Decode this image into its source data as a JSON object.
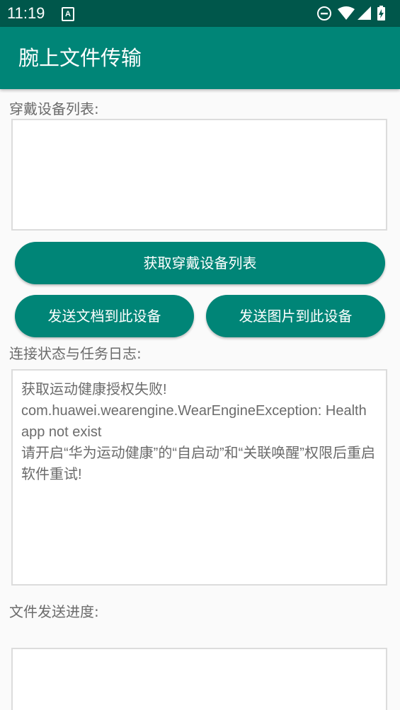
{
  "status_bar": {
    "time": "11:19",
    "notification_icon_letter": "A",
    "icons": [
      "dnd-icon",
      "wifi-icon",
      "signal-icon",
      "battery-icon"
    ]
  },
  "app_bar": {
    "title": "腕上文件传输"
  },
  "device_list": {
    "label": "穿戴设备列表:",
    "items": []
  },
  "buttons": {
    "get_devices": "获取穿戴设备列表",
    "send_document": "发送文档到此设备",
    "send_image": "发送图片到此设备"
  },
  "log": {
    "label": "连接状态与任务日志:",
    "text": "获取运动健康授权失败!\ncom.huawei.wearengine.WearEngineException: Health app not exist\n请开启“华为运动健康”的“自启动”和“关联唤醒”权限后重启软件重试!"
  },
  "progress": {
    "label": "文件发送进度:"
  },
  "colors": {
    "status_bar": "#00574b",
    "primary": "#008577",
    "text_gray": "#6b6b6b"
  }
}
